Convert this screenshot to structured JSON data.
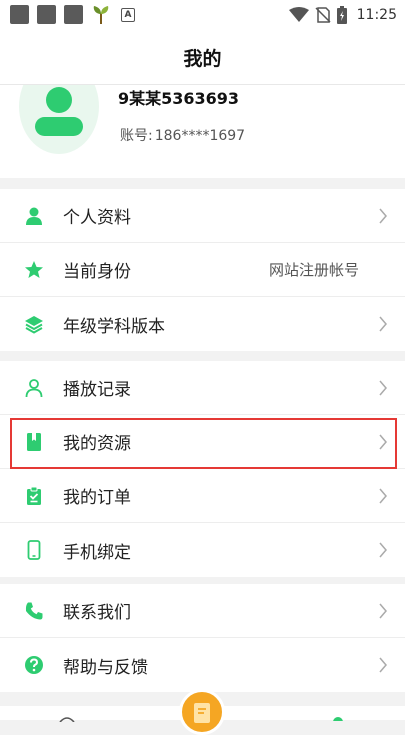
{
  "status_bar": {
    "time": "11:25",
    "icons": [
      "app-icon-1",
      "app-icon-2",
      "app-icon-3",
      "plant-icon",
      "a-icon",
      "wifi-icon",
      "no-sim-icon",
      "battery-icon"
    ]
  },
  "header": {
    "title": "我的"
  },
  "profile": {
    "username": "9某某5363693",
    "account_label": "账号:",
    "account_value": "186****1697"
  },
  "groups": [
    {
      "items": [
        {
          "label": "个人资料",
          "icon": "person-icon"
        },
        {
          "label": "当前身份",
          "icon": "star-icon",
          "value": "网站注册帐号"
        },
        {
          "label": "年级学科版本",
          "icon": "layers-icon"
        }
      ]
    },
    {
      "items": [
        {
          "label": "播放记录",
          "icon": "person-outline-icon"
        },
        {
          "label": "我的资源",
          "icon": "book-icon"
        },
        {
          "label": "我的订单",
          "icon": "clipboard-icon"
        },
        {
          "label": "手机绑定",
          "icon": "phone-icon"
        }
      ]
    },
    {
      "items": [
        {
          "label": "联系我们",
          "icon": "call-icon"
        },
        {
          "label": "帮助与反馈",
          "icon": "help-icon"
        }
      ]
    }
  ],
  "colors": {
    "accent": "#2ecc71",
    "highlight": "#e53935",
    "fab": "#f5a623"
  }
}
